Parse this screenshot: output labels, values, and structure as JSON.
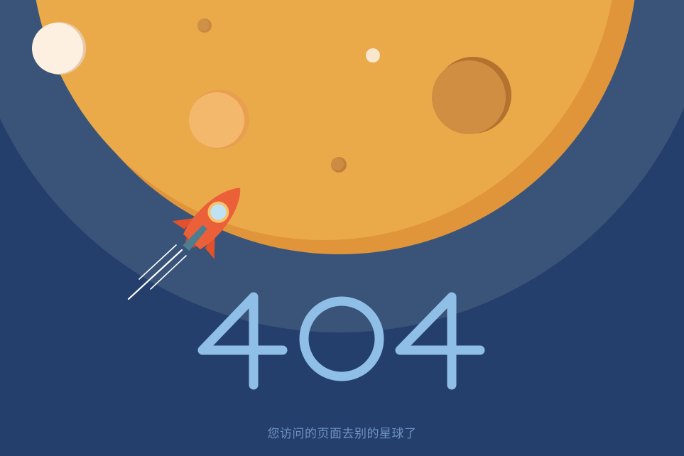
{
  "error_page": {
    "code_digits": [
      "4",
      "0",
      "4"
    ],
    "message": "您访问的页面去别的星球了"
  },
  "colors": {
    "background": "#243f6b",
    "halo": "#3a5479",
    "planet": "#ebaa4a",
    "planet_shadow": "#e0953a",
    "crater_dark": "#cf8e42",
    "crater_light": "#f4b86c",
    "rocket_body": "#eb6038",
    "rocket_window": "#bfe3f2",
    "code_stroke": "#8fbfe6",
    "message_text": "#6e93c4"
  }
}
